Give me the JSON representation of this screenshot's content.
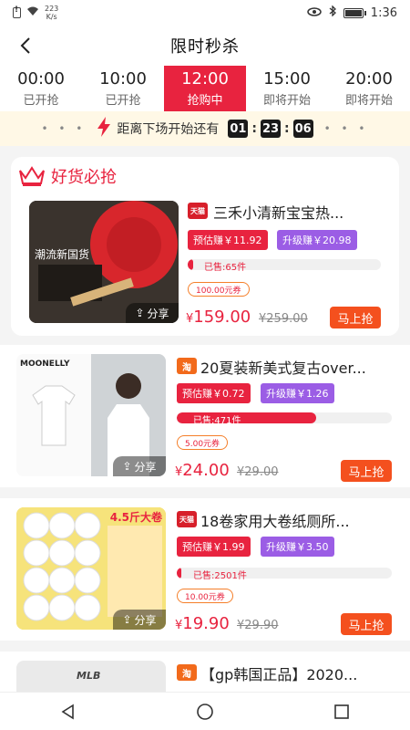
{
  "status_bar": {
    "net_speed": "223\nK/s",
    "time": "1:36"
  },
  "header": {
    "title": "限时秒杀"
  },
  "tabs": [
    {
      "time": "00:00",
      "status": "已开抢"
    },
    {
      "time": "10:00",
      "status": "已开抢"
    },
    {
      "time": "12:00",
      "status": "抢购中"
    },
    {
      "time": "15:00",
      "status": "即将开始"
    },
    {
      "time": "20:00",
      "status": "即将开始"
    }
  ],
  "countdown": {
    "label": "距离下场开始还有",
    "hh": "01",
    "mm": "23",
    "ss": "06"
  },
  "section": {
    "title": "好货必抢"
  },
  "products": [
    {
      "shop": "天猫",
      "title": "三禾小清新宝宝热...",
      "est_earn": "预估赚￥11.92",
      "up_earn": "升级赚￥20.98",
      "sold": "已售:65件",
      "sold_ratio": 0.03,
      "coupon": "100.00元券",
      "price": "159.00",
      "orig_price": "¥259.00",
      "buy_label": "马上抢",
      "share_label": "分享",
      "image_caption": "潮流新国货"
    },
    {
      "shop": "淘",
      "title": "20夏装新美式复古over...",
      "est_earn": "预估赚￥0.72",
      "up_earn": "升级赚￥1.26",
      "sold": "已售:471件",
      "sold_ratio": 0.65,
      "coupon": "5.00元券",
      "price": "24.00",
      "orig_price": "¥29.00",
      "buy_label": "马上抢",
      "share_label": "分享",
      "image_caption": "MOONELLY"
    },
    {
      "shop": "天猫",
      "title": "18卷家用大卷纸厕所...",
      "est_earn": "预估赚￥1.99",
      "up_earn": "升级赚￥3.50",
      "sold": "已售:2501件",
      "sold_ratio": 0.02,
      "coupon": "10.00元券",
      "price": "19.90",
      "orig_price": "¥29.90",
      "buy_label": "马上抢",
      "share_label": "分享",
      "image_caption": "4.5斤大卷"
    },
    {
      "shop": "淘",
      "title": "【gp韩国正品】2020...",
      "image_caption": "MLB"
    }
  ],
  "colors": {
    "accent": "#e8233f",
    "purple": "#9b5de5",
    "orange": "#f4501e"
  }
}
